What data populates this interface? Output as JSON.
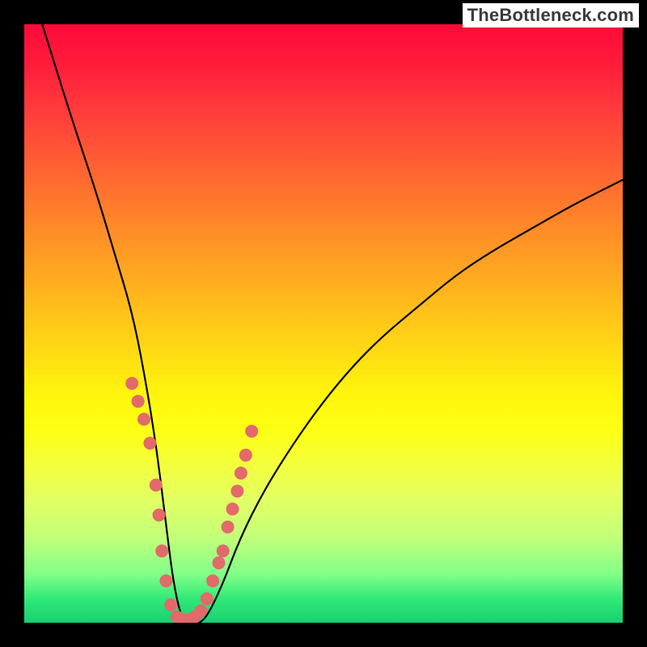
{
  "brand": {
    "label": "TheBottleneck.com"
  },
  "chart_data": {
    "type": "line",
    "title": "",
    "xlabel": "",
    "ylabel": "",
    "ylim": [
      0,
      100
    ],
    "xlim": [
      0,
      100
    ],
    "series": [
      {
        "name": "curve",
        "x": [
          3,
          8,
          12,
          15,
          18,
          20,
          22,
          23.5,
          25,
          26.5,
          28,
          30,
          33,
          36,
          40,
          45,
          50,
          55,
          60,
          66,
          72,
          78,
          85,
          92,
          100
        ],
        "values": [
          100,
          84,
          72,
          62,
          52,
          42,
          30,
          18,
          6,
          0,
          0,
          0,
          6,
          14,
          22,
          30,
          37,
          43,
          48,
          53,
          58,
          62,
          66,
          70,
          74
        ]
      }
    ],
    "markers": {
      "name": "dots",
      "color": "#e26a6a",
      "x": [
        18,
        19,
        20,
        21,
        22,
        22.5,
        23,
        23.7,
        24.5,
        25.5,
        26.5,
        27.5,
        28.5,
        29.5,
        30.5,
        31.5,
        32.5,
        33.2,
        34,
        34.8,
        35.6,
        36.2,
        37,
        38
      ],
      "values": [
        40,
        37,
        34,
        30,
        23,
        18,
        12,
        7,
        3,
        1,
        0.5,
        0.5,
        1,
        2,
        4,
        7,
        10,
        12,
        16,
        19,
        22,
        25,
        28,
        32
      ]
    },
    "gradient_stops": [
      {
        "pct": 0,
        "color": "#ff0a3a"
      },
      {
        "pct": 14,
        "color": "#ff3a3c"
      },
      {
        "pct": 30,
        "color": "#ff7a2c"
      },
      {
        "pct": 46,
        "color": "#ffb91c"
      },
      {
        "pct": 62,
        "color": "#fff60c"
      },
      {
        "pct": 80,
        "color": "#e0ff66"
      },
      {
        "pct": 100,
        "color": "#18d070"
      }
    ]
  }
}
